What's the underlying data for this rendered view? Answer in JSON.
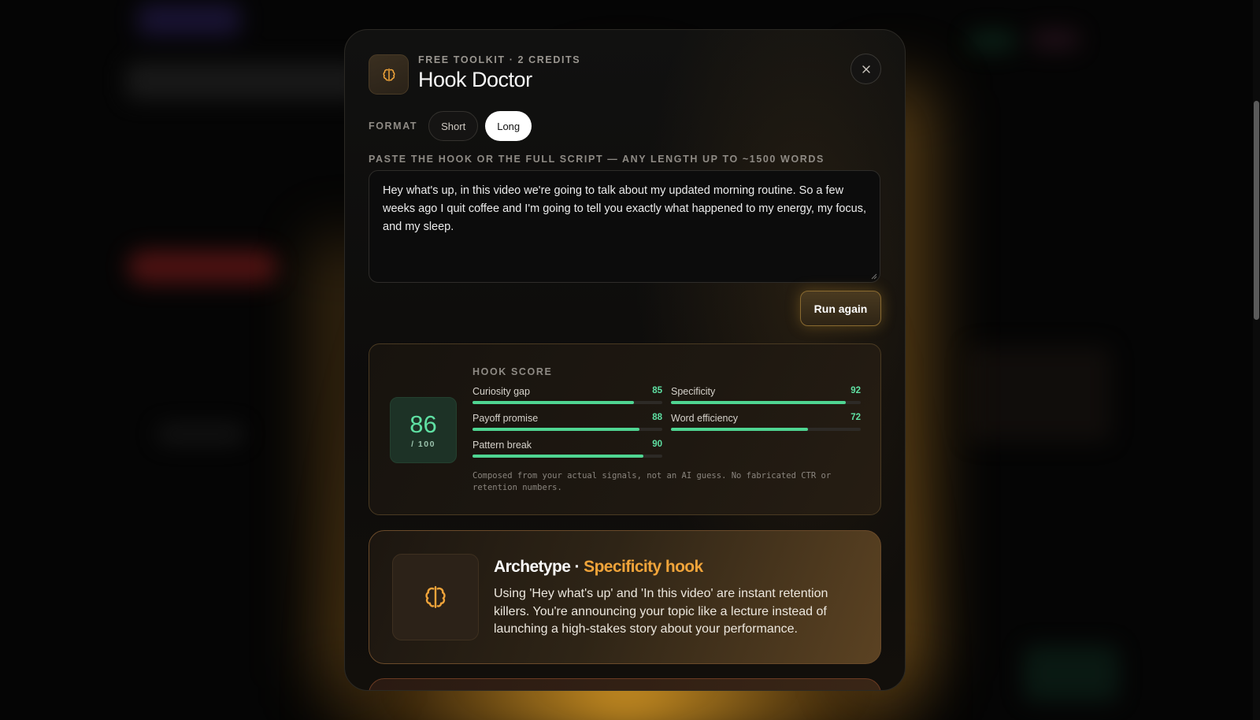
{
  "modal": {
    "eyebrow": "FREE TOOLKIT · 2 CREDITS",
    "title": "Hook Doctor",
    "app_icon": "brain-icon",
    "close_icon": "close-icon"
  },
  "format": {
    "label": "FORMAT",
    "options": [
      {
        "label": "Short",
        "selected": false
      },
      {
        "label": "Long",
        "selected": true
      }
    ]
  },
  "script_input": {
    "label": "PASTE THE HOOK OR THE FULL SCRIPT — ANY LENGTH UP TO ~1500 WORDS",
    "value": "Hey what's up, in this video we're going to talk about my updated morning routine. So a few weeks ago I quit coffee and I'm going to tell you exactly what happened to my energy, my focus, and my sleep."
  },
  "run_button": {
    "label": "Run again"
  },
  "hook_score": {
    "heading": "HOOK SCORE",
    "score": "86",
    "denominator": "/ 100",
    "score_color": "#5fe0a3",
    "metrics": [
      {
        "label": "Curiosity gap",
        "value": 85
      },
      {
        "label": "Specificity",
        "value": 92
      },
      {
        "label": "Payoff promise",
        "value": 88
      },
      {
        "label": "Word efficiency",
        "value": 72
      },
      {
        "label": "Pattern break",
        "value": 90
      }
    ],
    "note": "Composed from your actual signals, not an AI guess. No fabricated CTR or retention numbers."
  },
  "archetype": {
    "prefix": "Archetype · ",
    "name": "Specificity hook",
    "name_color": "#f0a43a",
    "description": "Using 'Hey what's up' and 'In this video' are instant retention killers. You're announcing your topic like a lecture instead of launching a high-stakes story about your performance.",
    "icon": "brain-icon"
  }
}
